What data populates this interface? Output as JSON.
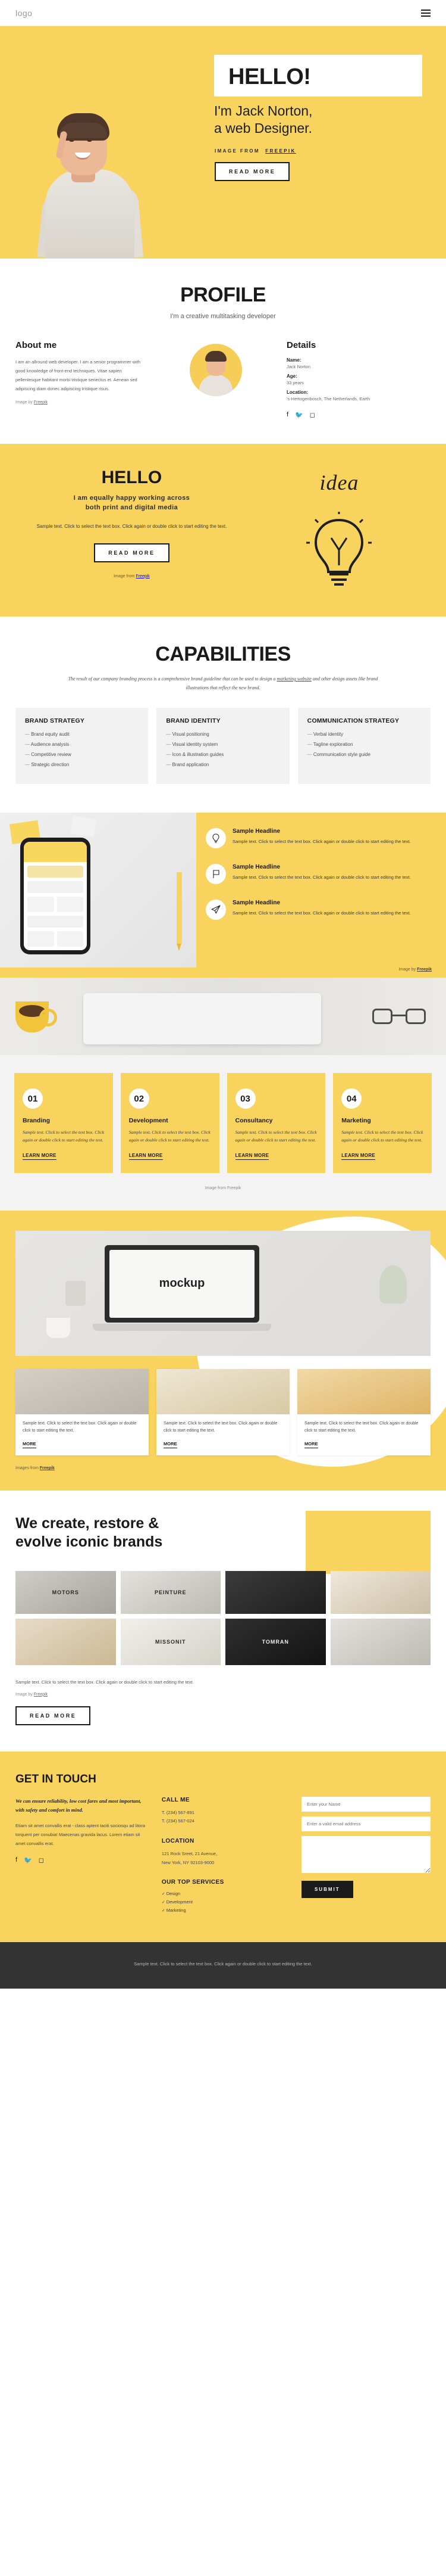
{
  "header": {
    "logo": "logo",
    "menu_icon": "hamburger-menu-icon"
  },
  "hero": {
    "title": "HELLO!",
    "subtitle_line1": "I'm Jack Norton,",
    "subtitle_line2": "a web Designer.",
    "credit_prefix": "IMAGE FROM",
    "credit_link": "FREEPIK",
    "cta": "READ MORE"
  },
  "profile": {
    "title": "PROFILE",
    "subtitle": "I'm a creative multitasking developer",
    "about_heading": "About me",
    "about_body": "I am an allround web developer. I am a senior programmer with good knowledge of front-end techniques. Vitae sapien pellentesque habitant morbi tristique senectus et. Aenean sed adipiscing diam donec adipiscing tristique risus.",
    "about_credit_prefix": "Image by",
    "about_credit_link": "Freepik",
    "details_heading": "Details",
    "details": [
      {
        "key": "Name:",
        "value": "Jack Norton"
      },
      {
        "key": "Age:",
        "value": "33 years"
      },
      {
        "key": "Location:",
        "value": "'s-Hertogenbosch, The Netherlands, Earth"
      }
    ],
    "socials": [
      "facebook-icon",
      "twitter-icon",
      "instagram-icon"
    ]
  },
  "hello": {
    "title": "HELLO",
    "tagline_line1": "I am equally happy working across",
    "tagline_line2": "both print and digital media",
    "body": "Sample text. Click to select the text box. Click again or double click to start editing the text.",
    "cta": "READ MORE",
    "credit_prefix": "Image from",
    "credit_link": "Freepik",
    "idea_word": "idea",
    "bulb_icon": "lightbulb-icon"
  },
  "capabilities": {
    "title": "CAPABILITIES",
    "lead_part1": "The result of our company branding process is a comprehensive brand guideline that can be used to design a ",
    "lead_link": "marketing website",
    "lead_part2": " and other design assets like brand illustrations that reflect the new brand.",
    "cards": [
      {
        "heading": "BRAND STRATEGY",
        "items": [
          "Brand equity audit",
          "Audience analysis",
          "Competitive review",
          "Strategic direction"
        ]
      },
      {
        "heading": "BRAND IDENTITY",
        "items": [
          "Visual positioning",
          "Visual identity system",
          "Icon & illustration guides",
          "Brand application"
        ]
      },
      {
        "heading": "COMMUNICATION STRATEGY",
        "items": [
          "Verbal identity",
          "Tagline exploration",
          "Communication style guide"
        ]
      }
    ]
  },
  "features": {
    "items": [
      {
        "icon": "lightbulb-icon",
        "headline": "Sample Headline",
        "body": "Sample text. Click to select the text box. Click again or double click to start editing the text."
      },
      {
        "icon": "flag-icon",
        "headline": "Sample Headline",
        "body": "Sample text. Click to select the text box. Click again or double click to start editing the text."
      },
      {
        "icon": "paper-plane-icon",
        "headline": "Sample Headline",
        "body": "Sample text. Click to select the text box. Click again or double click to start editing the text."
      }
    ],
    "credit_prefix": "Image by",
    "credit_link": "Freepik"
  },
  "services": {
    "cards": [
      {
        "number": "01",
        "title": "Branding",
        "body": "Sample text. Click to select the text box. Click again or double click to start editing the text.",
        "cta": "LEARN MORE"
      },
      {
        "number": "02",
        "title": "Development",
        "body": "Sample text. Click to select the text box. Click again or double click to start editing the text.",
        "cta": "LEARN MORE"
      },
      {
        "number": "03",
        "title": "Consultancy",
        "body": "Sample text. Click to select the text box. Click again or double click to start editing the text.",
        "cta": "LEARN MORE"
      },
      {
        "number": "04",
        "title": "Marketing",
        "body": "Sample text. Click to select the text box. Click again or double click to start editing the text.",
        "cta": "LEARN MORE"
      }
    ],
    "credit": "Image from Freepik"
  },
  "mockup": {
    "screen_label": "mockup",
    "thumbs": [
      {
        "body": "Sample text. Click to select the text box. Click again or double click to start editing the text.",
        "cta": "MORE"
      },
      {
        "body": "Sample text. Click to select the text box. Click again or double click to start editing the text.",
        "cta": "MORE"
      },
      {
        "body": "Sample text. Click to select the text box. Click again or double click to start editing the text.",
        "cta": "MORE"
      }
    ],
    "credit_prefix": "Images from",
    "credit_link": "Freepik"
  },
  "brands": {
    "title_line1": "We create, restore &",
    "title_line2": "evolve iconic brands",
    "tiles": [
      {
        "label": "MOTORS",
        "dark": false
      },
      {
        "label": "PEINTURE",
        "dark": false
      },
      {
        "label": "",
        "dark": true
      },
      {
        "label": "",
        "dark": false
      },
      {
        "label": "",
        "dark": false
      },
      {
        "label": "MISSONIT",
        "dark": false
      },
      {
        "label": "TOMRAN",
        "dark": true
      }
    ],
    "body": "Sample text. Click to select the text box. Click again or double click to start editing the text.",
    "credit_prefix": "Image by",
    "credit_link": "Freepik",
    "cta": "READ MORE"
  },
  "contact": {
    "title": "GET IN TOUCH",
    "intro_bold": "We can ensure reliability, low cost fares and most important, with safety and comfort in mind.",
    "intro_body": "Etiam sit amet convallis erat - class aptent taciti sociosqu ad litora torquent per conubia! Maecenas gravida lacus. Lorem etiam sit amet convallis erat.",
    "socials": [
      "facebook-icon",
      "twitter-icon",
      "instagram-icon"
    ],
    "call_heading": "CALL ME",
    "phones": [
      "T. (234) 567-891",
      "T. (234) 567-024"
    ],
    "location_heading": "LOCATION",
    "address_line1": "121 Rock Sreet, 21 Avenue,",
    "address_line2": "New York, NY 92103-9000",
    "services_heading": "OUR TOP SERVICES",
    "services": [
      "Design",
      "Development",
      "Marketing"
    ],
    "form": {
      "name_placeholder": "Enter your Name",
      "email_placeholder": "Enter a valid email address",
      "message_placeholder": "",
      "submit": "SUBMIT"
    }
  },
  "footer": {
    "text": "Sample text. Click to select the text box. Click again or double click to start editing the text."
  }
}
